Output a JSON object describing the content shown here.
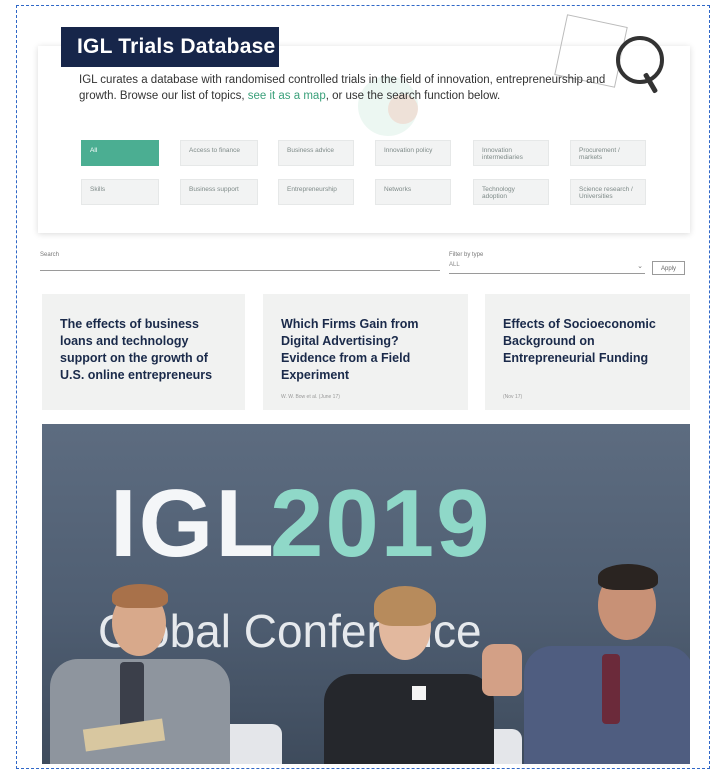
{
  "db": {
    "title": "IGL Trials Database",
    "description_pre": "IGL curates a database with randomised controlled trials in the field of innovation, entrepreneurship and growth. Browse our list of topics, ",
    "description_link": "see it as a map",
    "description_post": ", or use the search function below."
  },
  "topics": [
    {
      "label": "All"
    },
    {
      "label": "Access to finance"
    },
    {
      "label": "Business advice"
    },
    {
      "label": "Innovation policy"
    },
    {
      "label": "Innovation intermediaries"
    },
    {
      "label": "Procurement / markets"
    },
    {
      "label": "Skills"
    },
    {
      "label": "Business support"
    },
    {
      "label": "Entrepreneurship"
    },
    {
      "label": "Networks"
    },
    {
      "label": "Technology adoption"
    },
    {
      "label": "Science research / Universities"
    }
  ],
  "search": {
    "label": "Search",
    "filter_label": "Filter by type",
    "filter_value": "ALL",
    "apply": "Apply"
  },
  "papers": [
    {
      "title": "The effects of business loans and technology support on the growth of U.S. online entrepreneurs",
      "meta": ""
    },
    {
      "title": "Which Firms Gain from Digital Advertising? Evidence from a Field Experiment",
      "meta": "W. W. Bow et al. (June 17)"
    },
    {
      "title": "Effects of Socioeconomic Background on Entrepreneurial Funding",
      "meta": "(Nov 17)"
    }
  ],
  "photo": {
    "igl": "IGL",
    "year": "2019",
    "subtitle": "Global Conference"
  },
  "colors": {
    "title_bg": "#17264a",
    "accent": "#4bae92",
    "link": "#3aa07a",
    "photo_year": "#8fd8c8"
  }
}
